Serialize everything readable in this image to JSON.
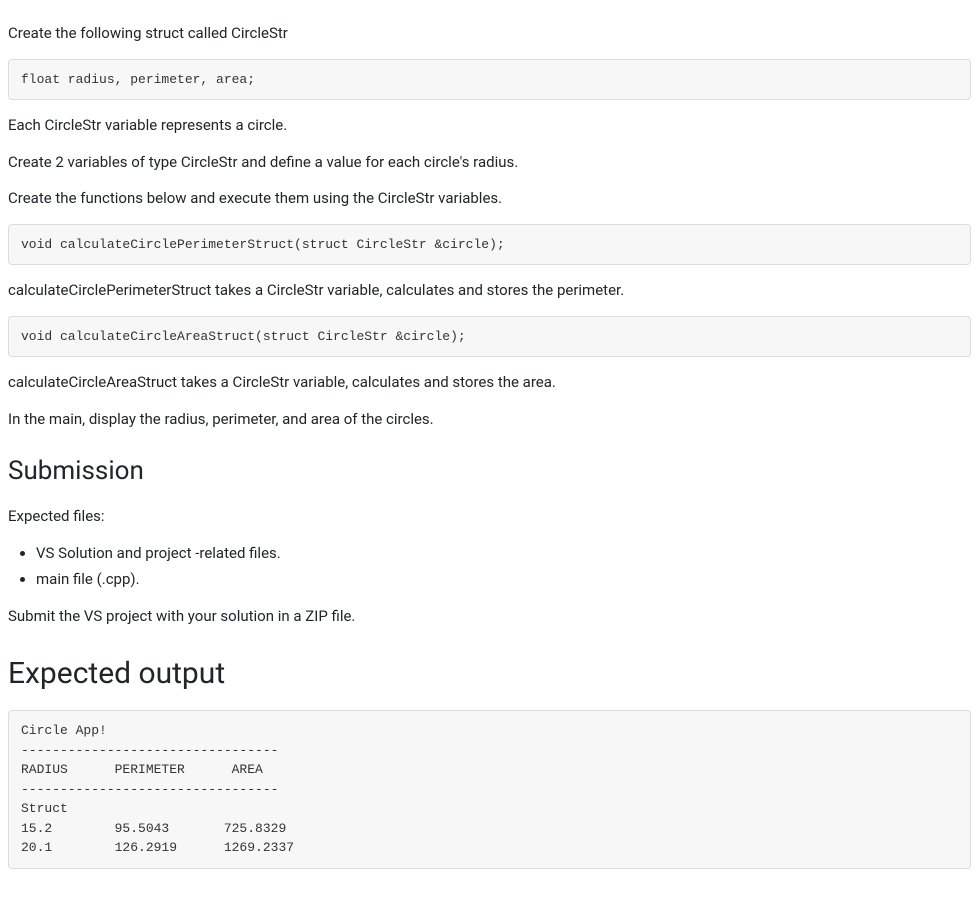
{
  "paragraphs": {
    "p1": "Create the following struct called CircleStr",
    "p2": "Each CircleStr variable represents a circle.",
    "p3": "Create 2 variables of type CircleStr and define a value for each circle's radius.",
    "p4": "Create the functions below and execute them using the CircleStr variables.",
    "p5": "calculateCirclePerimeterStruct takes a CircleStr variable, calculates and stores the perimeter.",
    "p6": "calculateCircleAreaStruct takes a CircleStr variable, calculates and stores the area.",
    "p7": "In the main, display the radius, perimeter, and area of the circles.",
    "p8": "Expected files:",
    "p9": "Submit the VS project with your solution in a ZIP file."
  },
  "code": {
    "structDef": "float radius, perimeter, area;",
    "func1": "void calculateCirclePerimeterStruct(struct CircleStr &circle);",
    "func2": "void calculateCircleAreaStruct(struct CircleStr &circle);",
    "output": "Circle App!\n---------------------------------\nRADIUS      PERIMETER      AREA\n---------------------------------\nStruct\n15.2        95.5043       725.8329\n20.1        126.2919      1269.2337"
  },
  "headings": {
    "submission": "Submission",
    "expectedOutput": "Expected output"
  },
  "list": {
    "item1": "VS Solution and project -related files.",
    "item2": "main file (.cpp)."
  }
}
